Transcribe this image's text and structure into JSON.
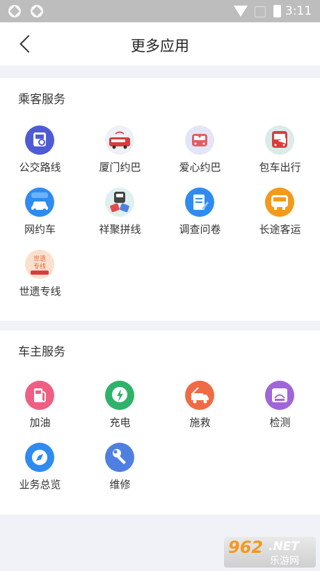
{
  "status_bar": {
    "time": "3:11"
  },
  "header": {
    "title": "更多应用"
  },
  "passenger": {
    "title": "乘客服务",
    "items": [
      {
        "label": "公交路线",
        "icon": "bus-route-icon",
        "color": "#4f5bd5"
      },
      {
        "label": "厦门约巴",
        "icon": "xiamen-bus-icon",
        "color": "#e24b4b"
      },
      {
        "label": "爱心约巴",
        "icon": "love-bus-icon",
        "color": "#e25d63"
      },
      {
        "label": "包车出行",
        "icon": "charter-bus-icon",
        "color": "#e24b4b"
      },
      {
        "label": "网约车",
        "icon": "ride-hailing-icon",
        "color": "#2f8bf0"
      },
      {
        "label": "祥聚拼线",
        "icon": "carpool-line-icon",
        "color": "#e24b4b"
      },
      {
        "label": "调查问卷",
        "icon": "survey-icon",
        "color": "#2f8bf0"
      },
      {
        "label": "长途客运",
        "icon": "long-distance-bus-icon",
        "color": "#f39a1c"
      },
      {
        "label": "世遗专线",
        "icon": "heritage-line-icon",
        "color": "#e86a3a"
      }
    ]
  },
  "owner": {
    "title": "车主服务",
    "items": [
      {
        "label": "加油",
        "icon": "fuel-icon",
        "color": "#ef5f83"
      },
      {
        "label": "充电",
        "icon": "charging-icon",
        "color": "#2fb36a"
      },
      {
        "label": "施救",
        "icon": "rescue-truck-icon",
        "color": "#ef6b45"
      },
      {
        "label": "检测",
        "icon": "inspection-icon",
        "color": "#a066d8"
      },
      {
        "label": "业务总览",
        "icon": "compass-icon",
        "color": "#2f8bf0"
      },
      {
        "label": "维修",
        "icon": "wrench-icon",
        "color": "#4f7fe0"
      }
    ]
  },
  "watermark": {
    "brand_number": "962",
    "brand_suffix": ".NET",
    "site_name": "乐游网"
  }
}
